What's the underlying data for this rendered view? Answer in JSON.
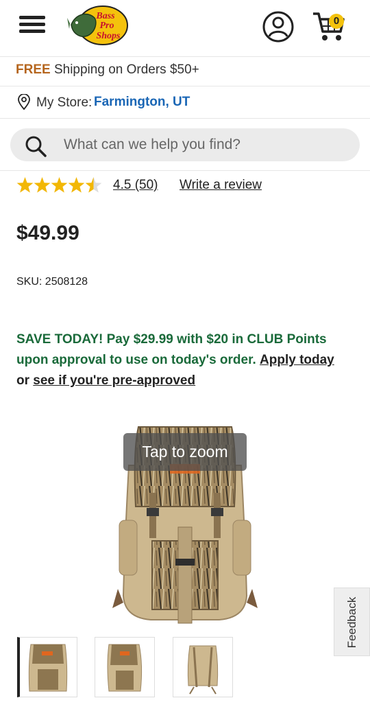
{
  "header": {
    "logo_text": [
      "Bass",
      "Pro",
      "Shops"
    ],
    "cart_count": "0"
  },
  "shipping": {
    "free_label": "FREE",
    "text": " Shipping on Orders $50+"
  },
  "store": {
    "label": "My Store:",
    "name": "Farmington, UT"
  },
  "search": {
    "placeholder": "What can we help you find?"
  },
  "product": {
    "rating_value": 4.5,
    "rating_max": 5,
    "rating_link": "4.5 (50)",
    "review_link": "Write a review",
    "price": "$49.99",
    "sku": "SKU: 2508128",
    "promo_main": "SAVE TODAY! Pay $29.99 with $20 in CLUB Points upon approval to use on today's order.",
    "promo_apply": "Apply today",
    "promo_or": "or ",
    "promo_preapproved": "see if you're pre-approved",
    "zoom_hint": "Tap to zoom",
    "thumbnail_count": 3
  },
  "feedback": {
    "label": "Feedback"
  },
  "colors": {
    "free_orange": "#b5651d",
    "store_blue": "#1a66b5",
    "promo_green": "#1a6a3a",
    "star_gold": "#f2b705",
    "cart_badge": "#f4c20d"
  }
}
